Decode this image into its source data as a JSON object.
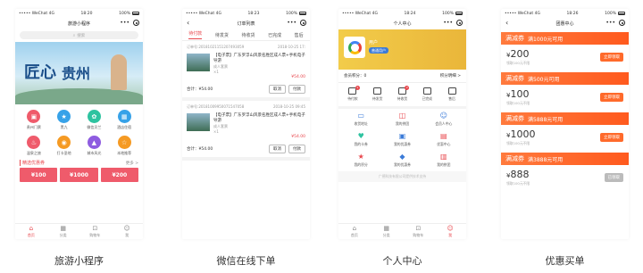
{
  "status_bar": {
    "carrier": "••••• WeChat 4G",
    "battery": "100%"
  },
  "phone1": {
    "time": "18:20",
    "title": "旅游小程序",
    "search_placeholder": "搜索",
    "banner_title_a": "匠心",
    "banner_title_b": "贵州",
    "banner_sub": "多彩贵州 · 醉美山水",
    "grid": [
      {
        "label": "贵州门票",
        "color": "#ef5b6b",
        "icon": "ticket-icon",
        "glyph": "▣"
      },
      {
        "label": "黑九",
        "color": "#37a2e8",
        "icon": "tag-icon",
        "glyph": "★"
      },
      {
        "label": "微信贝兰",
        "color": "#2ec3a0",
        "icon": "leaf-icon",
        "glyph": "✿"
      },
      {
        "label": "酒店住宿",
        "color": "#37a2e8",
        "icon": "hotel-icon",
        "glyph": "▦"
      },
      {
        "label": "温泉之旅",
        "color": "#ef5b6b",
        "icon": "spa-icon",
        "glyph": "♨"
      },
      {
        "label": "打卡圣地",
        "color": "#f59a23",
        "icon": "camera-icon",
        "glyph": "◉"
      },
      {
        "label": "城市风光",
        "color": "#8e5ce0",
        "icon": "city-icon",
        "glyph": "▲"
      },
      {
        "label": "本地推荐",
        "color": "#f59a23",
        "icon": "star-icon",
        "glyph": "☆"
      }
    ],
    "section_title": "精选优惠券",
    "section_more": "更多 >",
    "coupons": [
      "¥100",
      "¥1000",
      "¥200"
    ],
    "tabs": [
      {
        "label": "首页",
        "icon": "home-icon",
        "glyph": "⌂",
        "active": true
      },
      {
        "label": "分类",
        "icon": "category-icon",
        "glyph": "▦",
        "active": false
      },
      {
        "label": "购物车",
        "icon": "cart-icon",
        "glyph": "⊡",
        "active": false
      },
      {
        "label": "我",
        "icon": "user-icon",
        "glyph": "☺",
        "active": false
      }
    ],
    "caption": "旅游小程序"
  },
  "phone2": {
    "time": "18:23",
    "title": "订单列表",
    "tabs": [
      "待付款",
      "待发货",
      "待收货",
      "已完成",
      "售后"
    ],
    "orders": [
      {
        "id": "订单号:20181021151207493059",
        "date": "2018-10-25 17:",
        "status": "待付款",
        "title": "【电子票】广东罗浮山风景名胜区成人票+手机电子导游",
        "sub": "成人套票",
        "qty": "×1",
        "price": "¥54.00",
        "total": "合计：¥54.00",
        "cancel": "取消",
        "pay": "付款"
      },
      {
        "id": "订单号:20181009950071547058",
        "date": "2018-10-25 09:45",
        "status": "待付款",
        "title": "【电子票】广东罗浮山风景名胜区成人票+手机电子导游",
        "sub": "成人套票",
        "qty": "×1",
        "price": "¥54.00",
        "total": "合计：¥54.00",
        "cancel": "取消",
        "pay": "付款"
      }
    ],
    "caption": "微信在线下单"
  },
  "phone3": {
    "time": "18:24",
    "title": "个人中心",
    "user_name": "用户",
    "user_badge": "普通用户",
    "points_label": "会员积分：0",
    "points_detail": "积分明细 >",
    "order_grid": [
      {
        "label": "待付款",
        "badge": "1"
      },
      {
        "label": "待发货",
        "badge": ""
      },
      {
        "label": "待收货",
        "badge": "2"
      },
      {
        "label": "已完成",
        "badge": ""
      },
      {
        "label": "售后",
        "badge": ""
      }
    ],
    "service_grid": [
      {
        "label": "收货地址",
        "icon": "address-icon",
        "glyph": "▭",
        "color": "#3b7bd8"
      },
      {
        "label": "我的拼团",
        "icon": "group-icon",
        "glyph": "◫",
        "color": "#e8474d"
      },
      {
        "label": "会员人中心",
        "icon": "member-icon",
        "glyph": "☺",
        "color": "#3b7bd8"
      },
      {
        "label": "我的卡券",
        "icon": "card-icon",
        "glyph": "♥",
        "color": "#2ec3a0"
      },
      {
        "label": "我的优惠券",
        "icon": "coupon-icon",
        "glyph": "▣",
        "color": "#3b7bd8"
      },
      {
        "label": "优惠中心",
        "icon": "gift-icon",
        "glyph": "▤",
        "color": "#e8474d"
      },
      {
        "label": "我的积分",
        "icon": "points-icon",
        "glyph": "★",
        "color": "#e8474d"
      },
      {
        "label": "我的优惠券",
        "icon": "ticket2-icon",
        "glyph": "◆",
        "color": "#3b7bd8"
      },
      {
        "label": "我的拼团",
        "icon": "group2-icon",
        "glyph": "▥",
        "color": "#e8474d"
      }
    ],
    "footer": "广德科技有限公司提供技术支持",
    "tabs": [
      {
        "label": "首页",
        "icon": "home-icon",
        "glyph": "⌂",
        "active": false
      },
      {
        "label": "分类",
        "icon": "category-icon",
        "glyph": "▦",
        "active": false
      },
      {
        "label": "购物车",
        "icon": "cart-icon",
        "glyph": "⊡",
        "active": false
      },
      {
        "label": "我",
        "icon": "user-icon",
        "glyph": "☺",
        "active": true
      }
    ],
    "caption": "个人中心"
  },
  "phone4": {
    "time": "18:26",
    "title": "团惠中心",
    "coupons": [
      {
        "tag": "满减券",
        "rule": "满1000元可用",
        "amount": "200",
        "note": "领取100元不限",
        "btn": "立即领取",
        "enabled": true
      },
      {
        "tag": "满减券",
        "rule": "满500元可用",
        "amount": "100",
        "note": "领取100元不限",
        "btn": "立即领取",
        "enabled": true
      },
      {
        "tag": "满减券",
        "rule": "满5888元可用",
        "amount": "1000",
        "note": "领取100元不限",
        "btn": "立即领取",
        "enabled": true
      },
      {
        "tag": "满减券",
        "rule": "满3888元可用",
        "amount": "888",
        "note": "领取100元不限",
        "btn": "已领取",
        "enabled": false
      }
    ],
    "caption": "优惠买单"
  },
  "colors": {
    "accent": "#e8474d",
    "orange": "#ff6a2b",
    "yellow": "#f2cc4a"
  }
}
